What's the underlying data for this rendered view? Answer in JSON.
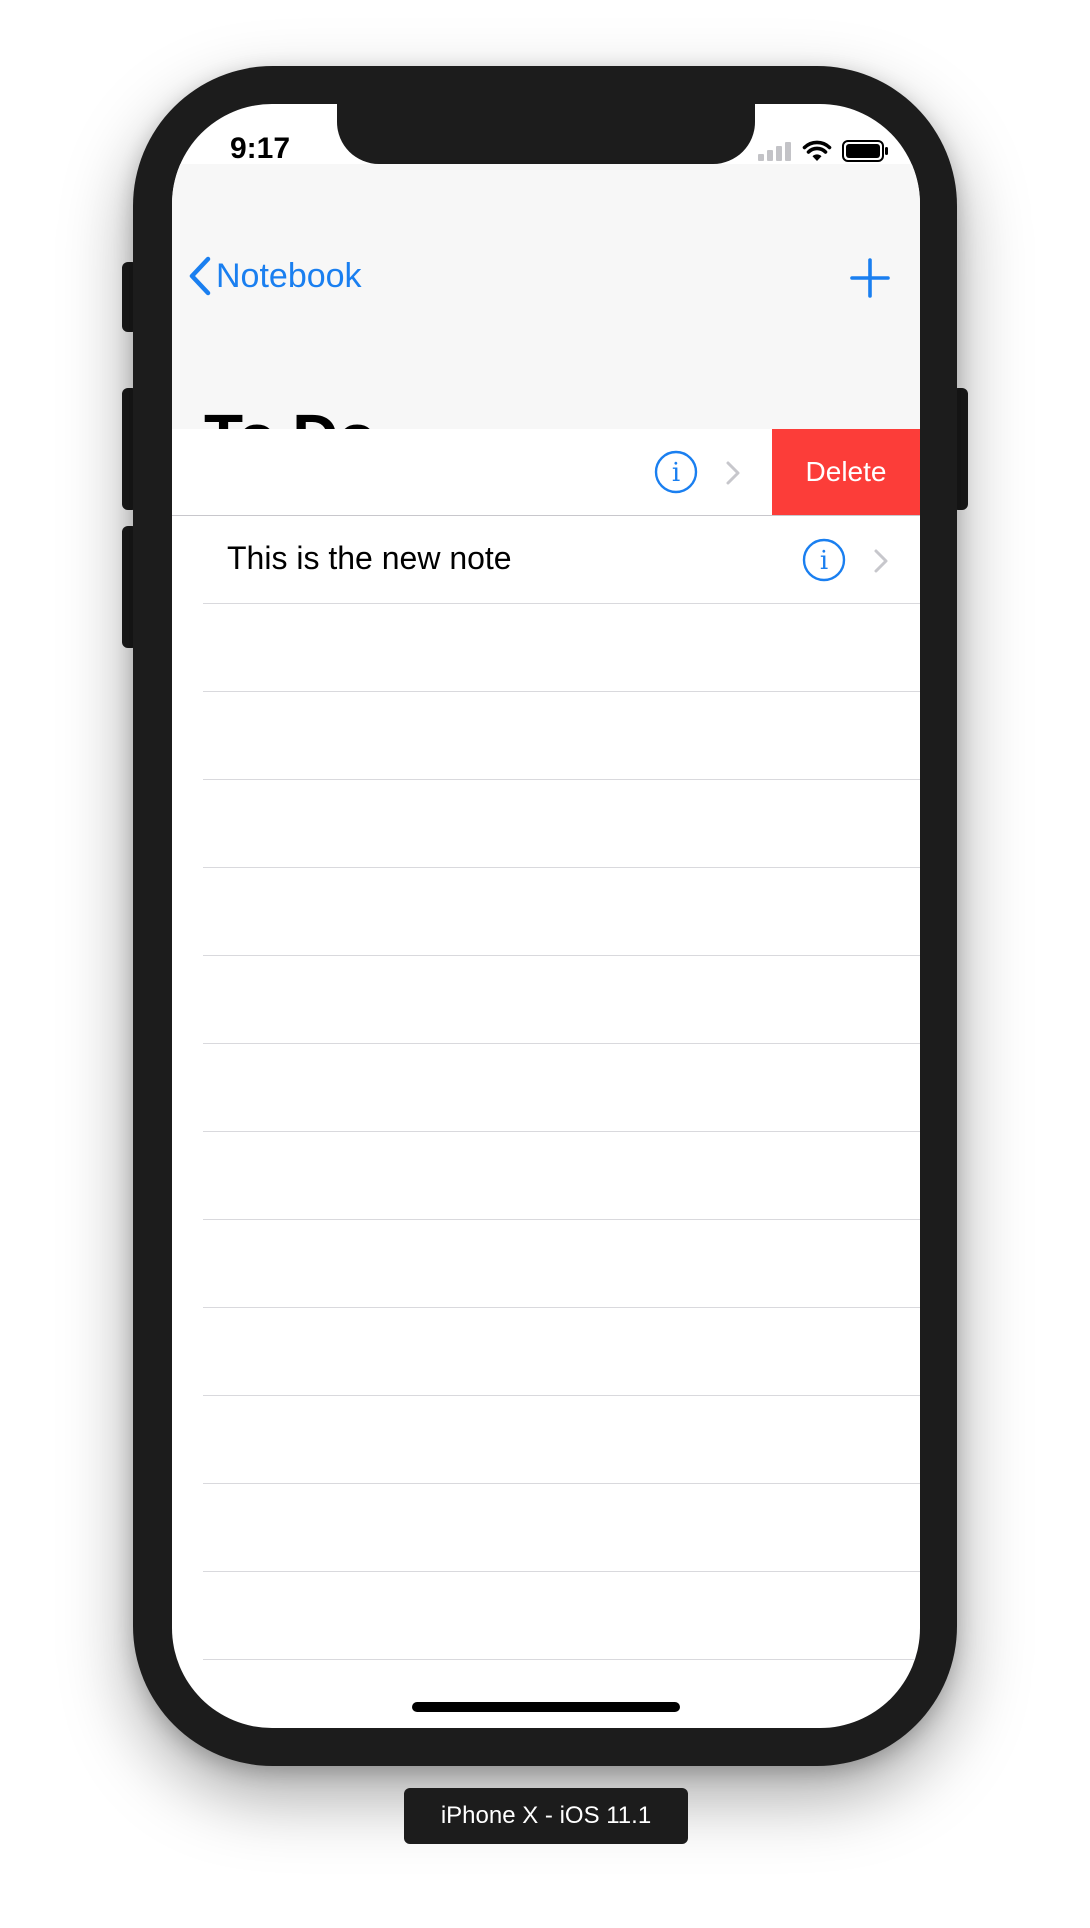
{
  "status_bar": {
    "time": "9:17"
  },
  "nav": {
    "back_label": "Notebook",
    "title": "To Do",
    "add_icon": "plus-icon"
  },
  "rows": [
    {
      "text": "",
      "swiped": true,
      "delete_label": "Delete"
    },
    {
      "text": "This is the new note",
      "swiped": false
    }
  ],
  "device_label": "iPhone X - iOS 11.1",
  "colors": {
    "accent": "#1a7ff0",
    "delete": "#fc3d39",
    "navbar_bg": "#f7f7f7"
  }
}
